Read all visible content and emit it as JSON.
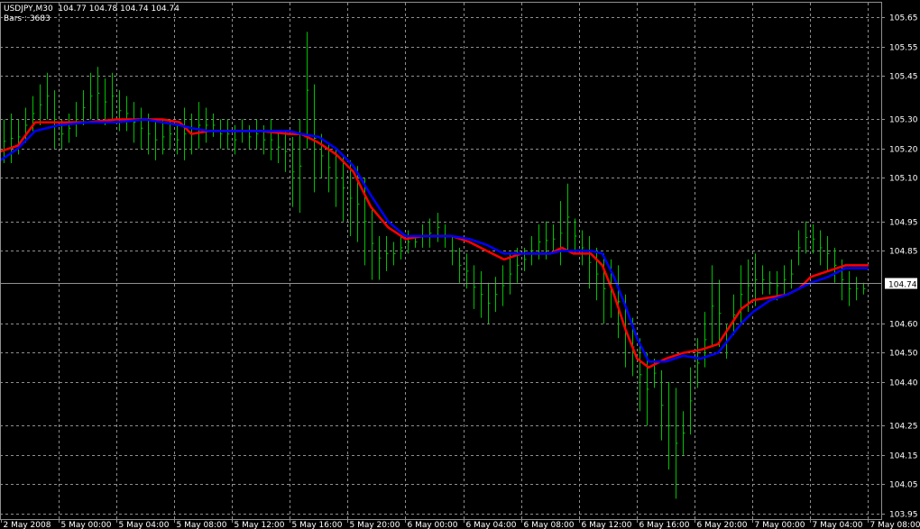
{
  "header": {
    "symbol_line": "USDJPY,M30  104.77 104.78 104.74 104.74",
    "bars_line": "Bars : 3683"
  },
  "colors": {
    "background": "#000000",
    "grid": "#8f8f8f",
    "bars": "#00c000",
    "fast_ma": "#ff0000",
    "slow_ma": "#0000ff",
    "axis_text": "#ffffff",
    "price_label_bg": "#ffffff",
    "price_label_text": "#000000"
  },
  "chart_data": {
    "type": "line",
    "symbol": "USDJPY",
    "timeframe": "M30",
    "ohlc": {
      "open": 104.77,
      "high": 104.78,
      "low": 104.74,
      "close": 104.74
    },
    "bars_count": 3683,
    "current_price": 104.74,
    "ylim": [
      103.93,
      105.7
    ],
    "y_ticks": [
      105.65,
      105.55,
      105.45,
      105.3,
      105.2,
      105.1,
      104.95,
      104.85,
      104.6,
      104.5,
      104.4,
      104.25,
      104.15,
      104.05,
      103.95
    ],
    "x_ticks": [
      "2 May 2008",
      "5 May 00:00",
      "5 May 04:00",
      "5 May 08:00",
      "5 May 12:00",
      "5 May 16:00",
      "5 May 20:00",
      "6 May 00:00",
      "6 May 04:00",
      "6 May 08:00",
      "6 May 12:00",
      "6 May 16:00",
      "6 May 20:00",
      "7 May 00:00",
      "7 May 04:00",
      "7 May 08:00"
    ],
    "x_range": [
      0,
      120
    ],
    "grid": true,
    "bars": [
      {
        "h": 105.3,
        "l": 105.15
      },
      {
        "h": 105.32,
        "l": 105.15
      },
      {
        "h": 105.3,
        "l": 105.18
      },
      {
        "h": 105.34,
        "l": 105.22
      },
      {
        "h": 105.38,
        "l": 105.26
      },
      {
        "h": 105.42,
        "l": 105.28
      },
      {
        "h": 105.46,
        "l": 105.3
      },
      {
        "h": 105.4,
        "l": 105.2
      },
      {
        "h": 105.3,
        "l": 105.2
      },
      {
        "h": 105.32,
        "l": 105.22
      },
      {
        "h": 105.36,
        "l": 105.24
      },
      {
        "h": 105.4,
        "l": 105.28
      },
      {
        "h": 105.46,
        "l": 105.3
      },
      {
        "h": 105.48,
        "l": 105.3
      },
      {
        "h": 105.44,
        "l": 105.28
      },
      {
        "h": 105.46,
        "l": 105.3
      },
      {
        "h": 105.4,
        "l": 105.26
      },
      {
        "h": 105.38,
        "l": 105.26
      },
      {
        "h": 105.36,
        "l": 105.22
      },
      {
        "h": 105.34,
        "l": 105.2
      },
      {
        "h": 105.32,
        "l": 105.18
      },
      {
        "h": 105.3,
        "l": 105.16
      },
      {
        "h": 105.3,
        "l": 105.18
      },
      {
        "h": 105.3,
        "l": 105.2
      },
      {
        "h": 105.28,
        "l": 105.18
      },
      {
        "h": 105.34,
        "l": 105.16
      },
      {
        "h": 105.32,
        "l": 105.18
      },
      {
        "h": 105.36,
        "l": 105.2
      },
      {
        "h": 105.34,
        "l": 105.22
      },
      {
        "h": 105.32,
        "l": 105.24
      },
      {
        "h": 105.3,
        "l": 105.2
      },
      {
        "h": 105.3,
        "l": 105.2
      },
      {
        "h": 105.28,
        "l": 105.18
      },
      {
        "h": 105.3,
        "l": 105.22
      },
      {
        "h": 105.28,
        "l": 105.2
      },
      {
        "h": 105.3,
        "l": 105.2
      },
      {
        "h": 105.28,
        "l": 105.18
      },
      {
        "h": 105.3,
        "l": 105.16
      },
      {
        "h": 105.26,
        "l": 105.15
      },
      {
        "h": 105.26,
        "l": 105.12
      },
      {
        "h": 105.24,
        "l": 105.0
      },
      {
        "h": 105.3,
        "l": 104.98
      },
      {
        "h": 105.6,
        "l": 105.2
      },
      {
        "h": 105.42,
        "l": 105.05
      },
      {
        "h": 105.25,
        "l": 105.1
      },
      {
        "h": 105.22,
        "l": 105.05
      },
      {
        "h": 105.2,
        "l": 105.0
      },
      {
        "h": 105.18,
        "l": 104.95
      },
      {
        "h": 105.16,
        "l": 104.9
      },
      {
        "h": 105.14,
        "l": 104.88
      },
      {
        "h": 105.1,
        "l": 104.8
      },
      {
        "h": 105.0,
        "l": 104.75
      },
      {
        "h": 104.9,
        "l": 104.75
      },
      {
        "h": 104.9,
        "l": 104.78
      },
      {
        "h": 104.88,
        "l": 104.8
      },
      {
        "h": 104.9,
        "l": 104.82
      },
      {
        "h": 104.92,
        "l": 104.84
      },
      {
        "h": 104.9,
        "l": 104.86
      },
      {
        "h": 104.94,
        "l": 104.86
      },
      {
        "h": 104.96,
        "l": 104.86
      },
      {
        "h": 104.98,
        "l": 104.88
      },
      {
        "h": 104.94,
        "l": 104.86
      },
      {
        "h": 104.9,
        "l": 104.8
      },
      {
        "h": 104.86,
        "l": 104.74
      },
      {
        "h": 104.84,
        "l": 104.72
      },
      {
        "h": 104.8,
        "l": 104.65
      },
      {
        "h": 104.78,
        "l": 104.62
      },
      {
        "h": 104.74,
        "l": 104.6
      },
      {
        "h": 104.76,
        "l": 104.64
      },
      {
        "h": 104.8,
        "l": 104.66
      },
      {
        "h": 104.84,
        "l": 104.7
      },
      {
        "h": 104.86,
        "l": 104.74
      },
      {
        "h": 104.86,
        "l": 104.78
      },
      {
        "h": 104.9,
        "l": 104.8
      },
      {
        "h": 104.94,
        "l": 104.82
      },
      {
        "h": 104.95,
        "l": 104.82
      },
      {
        "h": 104.94,
        "l": 104.84
      },
      {
        "h": 105.02,
        "l": 104.8
      },
      {
        "h": 105.08,
        "l": 104.85
      },
      {
        "h": 104.96,
        "l": 104.84
      },
      {
        "h": 104.92,
        "l": 104.8
      },
      {
        "h": 104.9,
        "l": 104.72
      },
      {
        "h": 104.86,
        "l": 104.68
      },
      {
        "h": 104.84,
        "l": 104.6
      },
      {
        "h": 104.82,
        "l": 104.62
      },
      {
        "h": 104.8,
        "l": 104.55
      },
      {
        "h": 104.7,
        "l": 104.45
      },
      {
        "h": 104.62,
        "l": 104.42
      },
      {
        "h": 104.55,
        "l": 104.3
      },
      {
        "h": 104.5,
        "l": 104.25
      },
      {
        "h": 104.48,
        "l": 104.38
      },
      {
        "h": 104.44,
        "l": 104.2
      },
      {
        "h": 104.4,
        "l": 104.1
      },
      {
        "h": 104.38,
        "l": 104.0
      },
      {
        "h": 104.3,
        "l": 104.15
      },
      {
        "h": 104.45,
        "l": 104.22
      },
      {
        "h": 104.55,
        "l": 104.38
      },
      {
        "h": 104.64,
        "l": 104.45
      },
      {
        "h": 104.8,
        "l": 104.52
      },
      {
        "h": 104.75,
        "l": 104.52
      },
      {
        "h": 104.6,
        "l": 104.48
      },
      {
        "h": 104.7,
        "l": 104.56
      },
      {
        "h": 104.8,
        "l": 104.6
      },
      {
        "h": 104.82,
        "l": 104.64
      },
      {
        "h": 104.84,
        "l": 104.66
      },
      {
        "h": 104.8,
        "l": 104.7
      },
      {
        "h": 104.78,
        "l": 104.7
      },
      {
        "h": 104.78,
        "l": 104.68
      },
      {
        "h": 104.8,
        "l": 104.7
      },
      {
        "h": 104.82,
        "l": 104.72
      },
      {
        "h": 104.92,
        "l": 104.8
      },
      {
        "h": 104.95,
        "l": 104.84
      },
      {
        "h": 104.94,
        "l": 104.84
      },
      {
        "h": 104.92,
        "l": 104.8
      },
      {
        "h": 104.9,
        "l": 104.78
      },
      {
        "h": 104.86,
        "l": 104.74
      },
      {
        "h": 104.82,
        "l": 104.68
      },
      {
        "h": 104.78,
        "l": 104.66
      },
      {
        "h": 104.76,
        "l": 104.68
      },
      {
        "h": 104.74,
        "l": 104.7
      }
    ],
    "series": [
      {
        "color": "#ff0000",
        "points": [
          [
            0,
            105.19
          ],
          [
            3,
            105.21
          ],
          [
            6,
            105.29
          ],
          [
            10,
            105.29
          ],
          [
            15,
            105.29
          ],
          [
            20,
            105.3
          ],
          [
            25,
            105.3
          ],
          [
            28,
            105.3
          ],
          [
            31,
            105.29
          ],
          [
            33,
            105.25
          ],
          [
            36,
            105.26
          ],
          [
            40,
            105.26
          ],
          [
            45,
            105.26
          ],
          [
            50,
            105.25
          ],
          [
            52,
            105.25
          ],
          [
            55,
            105.22
          ],
          [
            58,
            105.18
          ],
          [
            61,
            105.12
          ],
          [
            64,
            105.0
          ],
          [
            67,
            104.93
          ],
          [
            70,
            104.89
          ],
          [
            73,
            104.9
          ],
          [
            78,
            104.9
          ],
          [
            81,
            104.88
          ],
          [
            84,
            104.85
          ],
          [
            87,
            104.82
          ],
          [
            90,
            104.84
          ],
          [
            93,
            104.84
          ],
          [
            95,
            104.84
          ],
          [
            97,
            104.86
          ],
          [
            99,
            104.84
          ],
          [
            102,
            104.84
          ],
          [
            104,
            104.8
          ],
          [
            106,
            104.7
          ],
          [
            108,
            104.58
          ],
          [
            110,
            104.48
          ],
          [
            112,
            104.45
          ],
          [
            115,
            104.48
          ],
          [
            118,
            104.5
          ],
          [
            121,
            104.51
          ],
          [
            124,
            104.53
          ],
          [
            126,
            104.59
          ],
          [
            128,
            104.65
          ],
          [
            130,
            104.68
          ],
          [
            133,
            104.69
          ],
          [
            136,
            104.7
          ],
          [
            138,
            104.72
          ],
          [
            140,
            104.76
          ],
          [
            143,
            104.78
          ],
          [
            146,
            104.8
          ],
          [
            150,
            104.8
          ]
        ]
      },
      {
        "color": "#0000ff",
        "points": [
          [
            0,
            105.16
          ],
          [
            3,
            105.2
          ],
          [
            6,
            105.26
          ],
          [
            10,
            105.28
          ],
          [
            15,
            105.29
          ],
          [
            20,
            105.29
          ],
          [
            25,
            105.3
          ],
          [
            28,
            105.29
          ],
          [
            31,
            105.28
          ],
          [
            33,
            105.27
          ],
          [
            36,
            105.26
          ],
          [
            40,
            105.26
          ],
          [
            45,
            105.26
          ],
          [
            50,
            105.26
          ],
          [
            52,
            105.25
          ],
          [
            55,
            105.24
          ],
          [
            58,
            105.2
          ],
          [
            61,
            105.14
          ],
          [
            64,
            105.04
          ],
          [
            67,
            104.95
          ],
          [
            70,
            104.9
          ],
          [
            73,
            104.9
          ],
          [
            78,
            104.9
          ],
          [
            81,
            104.89
          ],
          [
            84,
            104.87
          ],
          [
            87,
            104.84
          ],
          [
            90,
            104.84
          ],
          [
            93,
            104.84
          ],
          [
            95,
            104.84
          ],
          [
            97,
            104.85
          ],
          [
            99,
            104.85
          ],
          [
            102,
            104.85
          ],
          [
            104,
            104.84
          ],
          [
            106,
            104.76
          ],
          [
            108,
            104.66
          ],
          [
            110,
            104.55
          ],
          [
            112,
            104.47
          ],
          [
            115,
            104.47
          ],
          [
            118,
            104.49
          ],
          [
            121,
            104.48
          ],
          [
            124,
            104.5
          ],
          [
            126,
            104.55
          ],
          [
            128,
            104.6
          ],
          [
            130,
            104.64
          ],
          [
            133,
            104.68
          ],
          [
            136,
            104.7
          ],
          [
            138,
            104.72
          ],
          [
            140,
            104.74
          ],
          [
            143,
            104.76
          ],
          [
            146,
            104.79
          ],
          [
            150,
            104.79
          ]
        ]
      }
    ]
  }
}
